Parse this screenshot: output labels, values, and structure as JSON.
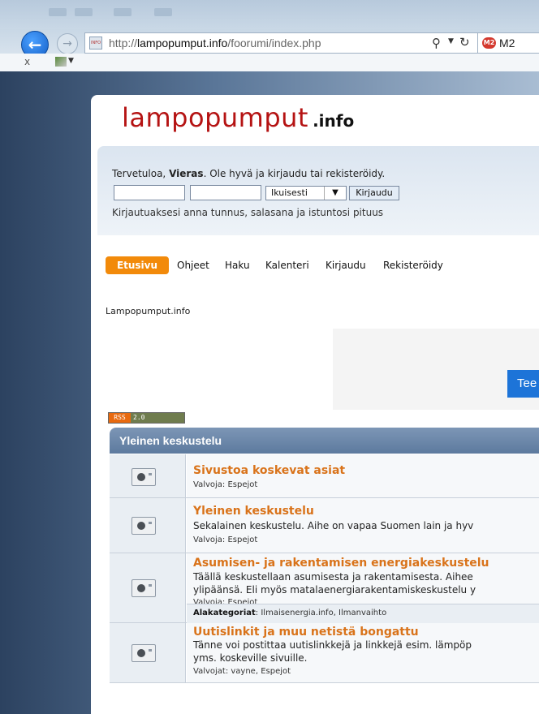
{
  "browser": {
    "url_domain": "lampopumput.info",
    "url_path": "/foorumi/index.php",
    "url_prefix": "http://",
    "tab_label": "M2",
    "tab_icon": "M2",
    "close_label": "x"
  },
  "site": {
    "logo_main": "lampopumput",
    "logo_tld": ".info"
  },
  "login": {
    "welcome_prefix": "Tervetuloa, ",
    "welcome_user": "Vieras",
    "welcome_suffix": ". Ole hyvä ja kirjaudu tai rekisteröidy.",
    "duration_selected": "Ikuisesti",
    "login_button": "Kirjaudu",
    "hint": "Kirjautuaksesi anna tunnus, salasana ja istuntosi pituus"
  },
  "menu": {
    "active": "Etusivu",
    "items": [
      "Ohjeet",
      "Haku",
      "Kalenteri",
      "Kirjaudu",
      "Rekisteröidy"
    ]
  },
  "breadcrumb": "Lampopumput.info",
  "ad": {
    "button_label": "Tee"
  },
  "rss": {
    "label": "RSS",
    "version": "2.0"
  },
  "category": {
    "title": "Yleinen keskustelu",
    "boards": [
      {
        "title": "Sivustoa koskevat asiat",
        "desc": [],
        "moderators": "Valvoja: Espejot"
      },
      {
        "title": "Yleinen keskustelu",
        "desc": [
          "Sekalainen keskustelu. Aihe on vapaa Suomen lain ja hyv"
        ],
        "moderators": "Valvoja: Espejot"
      },
      {
        "title": "Asumisen- ja rakentamisen energiakeskustelu",
        "desc": [
          "Täällä keskustellaan asumisesta ja rakentamisesta. Aihee",
          "ylipäänsä. Eli myös matalaenergiarakentamiskeskustelu y"
        ],
        "moderators": "Valvoja: Espejot",
        "subcats_label": "Alakategoriat",
        "subcats_value": ": Ilmaisenergia.info, Ilmanvaihto"
      },
      {
        "title": "Uutislinkit ja muu netistä bongattu",
        "desc": [
          "Tänne voi postittaa uutislinkkejä ja linkkejä esim. lämpöp",
          "yms. koskeville sivuille."
        ],
        "moderators": "Valvojat: vayne, Espejot"
      }
    ]
  }
}
